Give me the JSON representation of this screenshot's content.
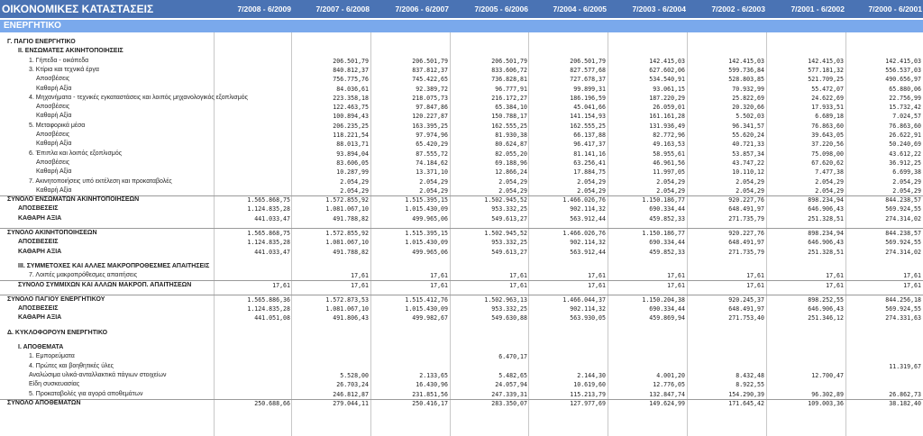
{
  "header": {
    "title": "ΟΙΚΟΝΟΜΙΚΕΣ ΚΑΤΑΣΤΑΣΕΙΣ",
    "periods": [
      "7/2008 - 6/2009",
      "7/2007 - 6/2008",
      "7/2006 - 6/2007",
      "7/2005 - 6/2006",
      "7/2004 - 6/2005",
      "7/2003 - 6/2004",
      "7/2002 - 6/2003",
      "7/2001 - 6/2002",
      "7/2000 - 6/2001"
    ]
  },
  "section_title": "ΕΝΕΡΓΗΤΙΚΟ",
  "rows": [
    {
      "label": "Γ. ΠΑΓΙΟ ΕΝΕΡΓΗΤΙΚΟ",
      "bold": true,
      "indent": 1,
      "values": [
        "",
        "",
        "",
        "",
        "",
        "",
        "",
        "",
        ""
      ]
    },
    {
      "label": "ΙΙ. ΕΝΣΩΜΑΤΕΣ ΑΚΙΝΗΤΟΠΟΙΗΣΕΙΣ",
      "bold": true,
      "indent": 2,
      "values": [
        "",
        "",
        "",
        "",
        "",
        "",
        "",
        "",
        ""
      ]
    },
    {
      "label": "1. Γήπεδα - οικόπεδα",
      "indent": 3,
      "values": [
        "",
        "206.501,79",
        "206.501,79",
        "206.501,79",
        "206.501,79",
        "142.415,03",
        "142.415,03",
        "142.415,03",
        "142.415,03"
      ]
    },
    {
      "label": "3. Κτίρια και τεχνικά έργα",
      "indent": 3,
      "values": [
        "",
        "840.812,37",
        "837.812,37",
        "833.606,72",
        "827.577,68",
        "627.602,06",
        "599.736,84",
        "577.181,32",
        "556.537,03"
      ]
    },
    {
      "label": "Αποσβέσεις",
      "indent": 4,
      "values": [
        "",
        "756.775,76",
        "745.422,65",
        "736.828,81",
        "727.678,37",
        "534.540,91",
        "528.803,85",
        "521.709,25",
        "490.656,97"
      ]
    },
    {
      "label": "Καθαρή Αξία",
      "indent": 4,
      "values": [
        "",
        "84.036,61",
        "92.389,72",
        "96.777,91",
        "99.899,31",
        "93.061,15",
        "70.932,99",
        "55.472,07",
        "65.880,06"
      ]
    },
    {
      "label": "4. Μηχανήματα - τεχνικές εγκαταστάσεις και λοιπός μηχανολογικός εξοπλισμός",
      "indent": 3,
      "values": [
        "",
        "223.358,18",
        "218.075,73",
        "216.172,27",
        "186.196,59",
        "187.220,29",
        "25.822,69",
        "24.622,69",
        "22.756,99"
      ]
    },
    {
      "label": "Αποσβέσεις",
      "indent": 4,
      "values": [
        "",
        "122.463,75",
        "97.847,86",
        "65.384,10",
        "45.041,66",
        "26.059,01",
        "20.320,66",
        "17.933,51",
        "15.732,42"
      ]
    },
    {
      "label": "Καθαρή Αξία",
      "indent": 4,
      "values": [
        "",
        "100.894,43",
        "120.227,87",
        "150.788,17",
        "141.154,93",
        "161.161,28",
        "5.502,03",
        "6.689,18",
        "7.024,57"
      ]
    },
    {
      "label": "5. Μεταφορικά μέσα",
      "indent": 3,
      "values": [
        "",
        "206.235,25",
        "163.395,25",
        "162.555,25",
        "162.555,25",
        "131.936,49",
        "96.341,57",
        "76.863,60",
        "76.863,60"
      ]
    },
    {
      "label": "Αποσβέσεις",
      "indent": 4,
      "values": [
        "",
        "118.221,54",
        "97.974,96",
        "81.930,38",
        "66.137,88",
        "82.772,96",
        "55.620,24",
        "39.643,05",
        "26.622,91"
      ]
    },
    {
      "label": "Καθαρή Αξία",
      "indent": 4,
      "values": [
        "",
        "88.013,71",
        "65.420,29",
        "80.624,87",
        "96.417,37",
        "49.163,53",
        "40.721,33",
        "37.220,56",
        "50.240,69"
      ]
    },
    {
      "label": "6. Έπιπλα και λοιπός εξοπλισμός",
      "indent": 3,
      "values": [
        "",
        "93.894,04",
        "87.555,72",
        "82.055,20",
        "81.141,16",
        "58.955,61",
        "53.857,34",
        "75.098,00",
        "43.612,22"
      ]
    },
    {
      "label": "Αποσβέσεις",
      "indent": 4,
      "values": [
        "",
        "83.606,05",
        "74.184,62",
        "69.188,96",
        "63.256,41",
        "46.961,56",
        "43.747,22",
        "67.620,62",
        "36.912,25"
      ]
    },
    {
      "label": "Καθαρή Αξία",
      "indent": 4,
      "values": [
        "",
        "10.287,99",
        "13.371,10",
        "12.866,24",
        "17.884,75",
        "11.997,05",
        "10.110,12",
        "7.477,38",
        "6.699,38"
      ]
    },
    {
      "label": "7. Ακινητοποιήσεις υπό εκτέλεση και προκαταβολές",
      "indent": 3,
      "values": [
        "",
        "2.054,29",
        "2.054,29",
        "2.054,29",
        "2.054,29",
        "2.054,29",
        "2.054,29",
        "2.054,29",
        "2.054,29"
      ]
    },
    {
      "label": "Καθαρή Αξία",
      "indent": 4,
      "underline": true,
      "values": [
        "",
        "2.054,29",
        "2.054,29",
        "2.054,29",
        "2.054,29",
        "2.054,29",
        "2.054,29",
        "2.054,29",
        "2.054,29"
      ]
    },
    {
      "label": "ΣΥΝΟΛΟ ΕΝΣΩΜΑΤΩΝ ΑΚΙΝΗΤΟΠΟΙΗΣΕΩΝ",
      "bold": true,
      "indent": 1,
      "values": [
        "1.565.868,75",
        "1.572.855,92",
        "1.515.395,15",
        "1.502.945,52",
        "1.466.026,76",
        "1.150.186,77",
        "920.227,76",
        "898.234,94",
        "844.238,57"
      ]
    },
    {
      "label": "ΑΠΟΣΒΕΣΕΙΣ",
      "bold": true,
      "indent": 2,
      "values": [
        "1.124.835,28",
        "1.081.067,10",
        "1.015.430,09",
        "953.332,25",
        "902.114,32",
        "690.334,44",
        "648.491,97",
        "646.906,43",
        "569.924,55"
      ]
    },
    {
      "label": "ΚΑΘΑΡΗ ΑΞΙΑ",
      "bold": true,
      "indent": 2,
      "values": [
        "441.033,47",
        "491.788,82",
        "499.965,06",
        "549.613,27",
        "563.912,44",
        "459.852,33",
        "271.735,79",
        "251.328,51",
        "274.314,02"
      ]
    },
    {
      "label": "",
      "indent": 1,
      "spacer": true,
      "values": [
        "",
        "",
        "",
        "",
        "",
        "",
        "",
        "",
        ""
      ]
    },
    {
      "label": "ΣΥΝΟΛΟ ΑΚΙΝΗΤΟΠΟΙΗΣΕΩΝ",
      "bold": true,
      "indent": 1,
      "topline": true,
      "values": [
        "1.565.868,75",
        "1.572.855,92",
        "1.515.395,15",
        "1.502.945,52",
        "1.466.026,76",
        "1.150.186,77",
        "920.227,76",
        "898.234,94",
        "844.238,57"
      ]
    },
    {
      "label": "ΑΠΟΣΒΕΣΕΙΣ",
      "bold": true,
      "indent": 2,
      "values": [
        "1.124.835,28",
        "1.081.067,10",
        "1.015.430,09",
        "953.332,25",
        "902.114,32",
        "690.334,44",
        "648.491,97",
        "646.906,43",
        "569.924,55"
      ]
    },
    {
      "label": "ΚΑΘΑΡΗ ΑΞΙΑ",
      "bold": true,
      "indent": 2,
      "values": [
        "441.033,47",
        "491.788,82",
        "499.965,06",
        "549.613,27",
        "563.912,44",
        "459.852,33",
        "271.735,79",
        "251.328,51",
        "274.314,02"
      ]
    },
    {
      "label": "",
      "indent": 1,
      "spacer": true,
      "values": [
        "",
        "",
        "",
        "",
        "",
        "",
        "",
        "",
        ""
      ]
    },
    {
      "label": "ΙΙΙ. ΣΥΜΜΕΤΟΧΕΣ ΚΑΙ ΑΛΛΕΣ ΜΑΚΡΟΠΡΟΘΕΣΜΕΣ ΑΠΑΙΤΗΣΕΙΣ",
      "bold": true,
      "indent": 2,
      "values": [
        "",
        "",
        "",
        "",
        "",
        "",
        "",
        "",
        ""
      ]
    },
    {
      "label": "7. Λοιπές μακροπρόθεσμες απαιτήσεις",
      "indent": 3,
      "underline": true,
      "values": [
        "",
        "17,61",
        "17,61",
        "17,61",
        "17,61",
        "17,61",
        "17,61",
        "17,61",
        "17,61"
      ]
    },
    {
      "label": "ΣΥΝΟΛΟ ΣΥΜΜΙΧΩΝ ΚΑΙ ΑΛΛΩΝ ΜΑΚΡΟΠ. ΑΠΑΙΤΗΣΕΩΝ",
      "bold": true,
      "indent": 2,
      "values": [
        "17,61",
        "17,61",
        "17,61",
        "17,61",
        "17,61",
        "17,61",
        "17,61",
        "17,61",
        "17,61"
      ]
    },
    {
      "label": "",
      "indent": 1,
      "spacer": true,
      "values": [
        "",
        "",
        "",
        "",
        "",
        "",
        "",
        "",
        ""
      ]
    },
    {
      "label": "ΣΥΝΟΛΟ ΠΑΓΙΟΥ ΕΝΕΡΓΗΤΙΚΟΥ",
      "bold": true,
      "indent": 1,
      "topline": true,
      "values": [
        "1.565.886,36",
        "1.572.873,53",
        "1.515.412,76",
        "1.502.963,13",
        "1.466.044,37",
        "1.150.204,38",
        "920.245,37",
        "898.252,55",
        "844.256,18"
      ]
    },
    {
      "label": "ΑΠΟΣΒΕΣΕΙΣ",
      "bold": true,
      "indent": 2,
      "values": [
        "1.124.835,28",
        "1.081.067,10",
        "1.015.430,09",
        "953.332,25",
        "902.114,32",
        "690.334,44",
        "648.491,97",
        "646.906,43",
        "569.924,55"
      ]
    },
    {
      "label": "ΚΑΘΑΡΗ ΑΞΙΑ",
      "bold": true,
      "indent": 2,
      "values": [
        "441.051,08",
        "491.806,43",
        "499.982,67",
        "549.630,88",
        "563.930,05",
        "459.869,94",
        "271.753,40",
        "251.346,12",
        "274.331,63"
      ]
    },
    {
      "label": "",
      "indent": 1,
      "spacer": true,
      "values": [
        "",
        "",
        "",
        "",
        "",
        "",
        "",
        "",
        ""
      ]
    },
    {
      "label": "Δ. ΚΥΚΛΟΦΟΡΟΥΝ ΕΝΕΡΓΗΤΙΚΟ",
      "bold": true,
      "indent": 1,
      "values": [
        "",
        "",
        "",
        "",
        "",
        "",
        "",
        "",
        ""
      ]
    },
    {
      "label": "",
      "indent": 1,
      "spacer": true,
      "values": [
        "",
        "",
        "",
        "",
        "",
        "",
        "",
        "",
        ""
      ]
    },
    {
      "label": "Ι. ΑΠΟΘΕΜΑΤΑ",
      "bold": true,
      "indent": 2,
      "values": [
        "",
        "",
        "",
        "",
        "",
        "",
        "",
        "",
        ""
      ]
    },
    {
      "label": "1. Εμπορεύματα",
      "indent": 3,
      "values": [
        "",
        "",
        "",
        "6.470,17",
        "",
        "",
        "",
        "",
        ""
      ]
    },
    {
      "label": "4. Πρώτες και βοηθητικές ύλες",
      "indent": 3,
      "values": [
        "",
        "",
        "",
        "",
        "",
        "",
        "",
        "",
        "11.319,67"
      ]
    },
    {
      "label": "Αναλώσιμα υλικά-ανταλλακτικά πάγιων στοιχείων",
      "indent": 3,
      "values": [
        "",
        "5.528,00",
        "2.133,65",
        "5.482,65",
        "2.144,30",
        "4.001,20",
        "8.432,48",
        "12.700,47",
        ""
      ]
    },
    {
      "label": "Είδη συσκευασίας",
      "indent": 3,
      "values": [
        "",
        "26.703,24",
        "16.430,96",
        "24.057,94",
        "10.619,60",
        "12.776,05",
        "8.922,55",
        "",
        ""
      ]
    },
    {
      "label": "5. Προκαταβολές για αγορά αποθεμάτων",
      "indent": 3,
      "underline": true,
      "values": [
        "",
        "246.812,87",
        "231.851,56",
        "247.339,31",
        "115.213,79",
        "132.847,74",
        "154.290,39",
        "96.302,89",
        "26.862,73"
      ]
    },
    {
      "label": "ΣΥΝΟΛΟ ΑΠΟΘΕΜΑΤΩΝ",
      "bold": true,
      "indent": 1,
      "values": [
        "250.688,66",
        "279.044,11",
        "250.416,17",
        "283.350,07",
        "127.977,69",
        "149.624,99",
        "171.645,42",
        "109.003,36",
        "38.182,40"
      ]
    }
  ]
}
